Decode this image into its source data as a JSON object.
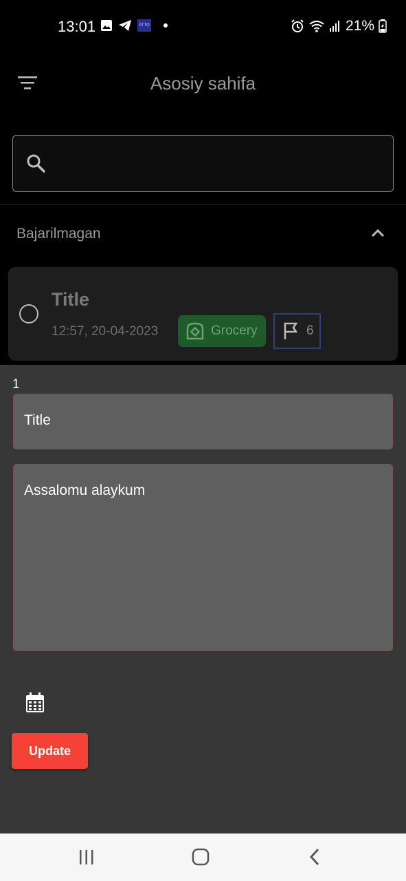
{
  "status_bar": {
    "time": "13:01",
    "left_icons": [
      "image-icon",
      "telegram-icon",
      "atto-icon",
      "dot"
    ],
    "atto_label": "ATTO",
    "right_icons": [
      "alarm-icon",
      "wifi-icon",
      "signal-icon",
      "battery-icon"
    ],
    "battery": "21%"
  },
  "app_bar": {
    "title": "Asosiy sahifa",
    "menu_icon": "filter-list-icon"
  },
  "search": {
    "icon": "search-icon",
    "value": "",
    "placeholder": ""
  },
  "section": {
    "label": "Bajarilmagan",
    "toggle_icon": "chevron-up-icon"
  },
  "task": {
    "title": "Title",
    "time": "12:57,  20-04-2023",
    "category": "Grocery",
    "category_icon": "bread-icon",
    "category_color": "#1f5a2a",
    "priority_icon": "flag-icon",
    "priority": "6"
  },
  "sheet": {
    "index": "1",
    "title_value": "Title",
    "description_value": "Assalomu alaykum",
    "calendar_icon": "calendar-icon",
    "update_label": "Update",
    "update_color": "#f44336"
  },
  "nav_bar": {
    "items": [
      "recent-apps-icon",
      "home-icon",
      "back-icon"
    ]
  }
}
